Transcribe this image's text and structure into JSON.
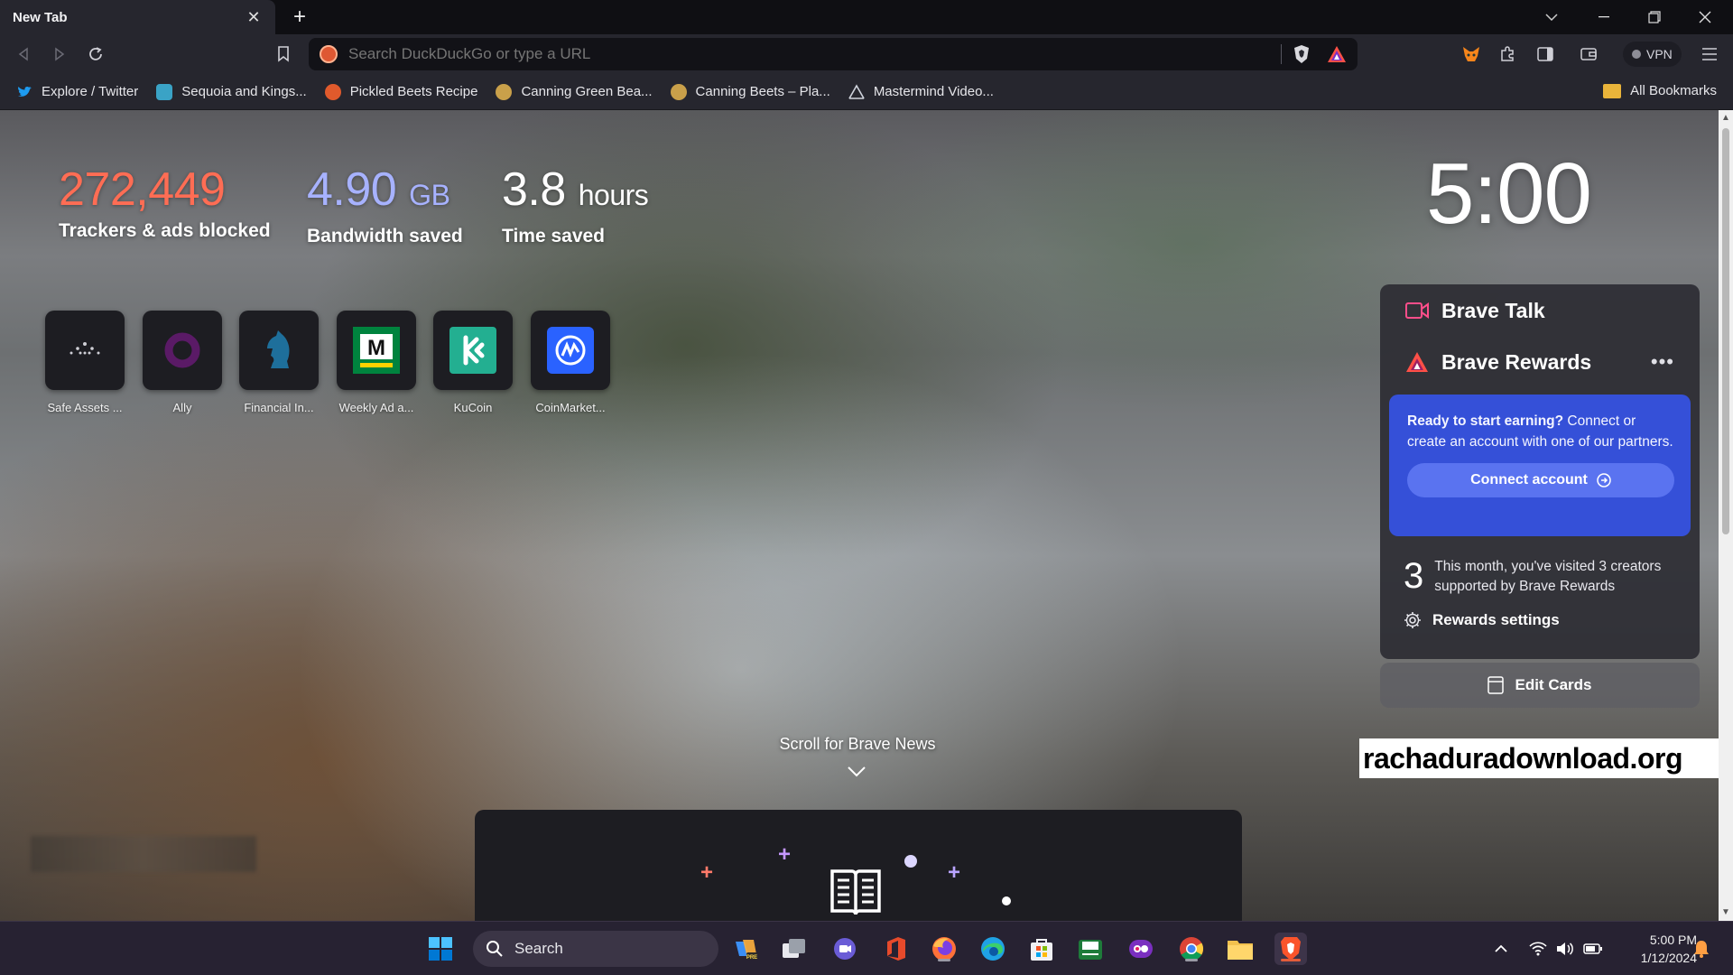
{
  "tab": {
    "title": "New Tab"
  },
  "toolbar": {
    "url_placeholder": "Search DuckDuckGo or type a URL",
    "vpn_label": "VPN"
  },
  "bookmarks": [
    {
      "label": "Explore / Twitter",
      "icon": "twitter-icon",
      "color": "#1d9bf0"
    },
    {
      "label": "Sequoia and Kings...",
      "icon": "nps-icon",
      "color": "#3aa3c6"
    },
    {
      "label": "Pickled Beets Recipe",
      "icon": "recipe-icon",
      "color": "#e05a2c"
    },
    {
      "label": "Canning Green Bea...",
      "icon": "canning-icon",
      "color": "#c9a04a"
    },
    {
      "label": "Canning Beets – Pla...",
      "icon": "canning-icon",
      "color": "#c9a04a"
    },
    {
      "label": "Mastermind Video...",
      "icon": "triangle-icon",
      "color": "#cfd3dc"
    }
  ],
  "all_bookmarks": "All Bookmarks",
  "stats": {
    "trackers": {
      "value": "272,449",
      "label": "Trackers & ads blocked",
      "color": "#ff6d54"
    },
    "bandwidth": {
      "value": "4.90",
      "unit": "GB",
      "label": "Bandwidth saved",
      "color": "#a7b2ff"
    },
    "time": {
      "value": "3.8",
      "unit": "hours",
      "label": "Time saved",
      "color": "#ffffff"
    }
  },
  "top_sites": [
    {
      "name": "Safe Assets ...",
      "icon": "safe-assets-icon"
    },
    {
      "name": "Ally",
      "icon": "ally-icon"
    },
    {
      "name": "Financial In...",
      "icon": "chess-knight-icon"
    },
    {
      "name": "Weekly Ad a...",
      "icon": "menards-icon"
    },
    {
      "name": "KuCoin",
      "icon": "kucoin-icon"
    },
    {
      "name": "CoinMarket...",
      "icon": "coinmarketcap-icon"
    }
  ],
  "clock": "5:00",
  "brave_talk": {
    "title": "Brave Talk"
  },
  "brave_rewards": {
    "title": "Brave Rewards",
    "prompt_bold": "Ready to start earning?",
    "prompt_rest": " Connect or create an account with one of our partners.",
    "connect_label": "Connect account",
    "creator_count": "3",
    "creator_text": "This month, you've visited 3 creators supported by Brave Rewards",
    "settings_label": "Rewards settings"
  },
  "edit_cards": "Edit Cards",
  "news": {
    "scroll_label": "Scroll for Brave News"
  },
  "watermark": "rachaduradownload.org",
  "taskbar": {
    "search_label": "Search",
    "time": "5:00 PM",
    "date": "1/12/2024"
  }
}
